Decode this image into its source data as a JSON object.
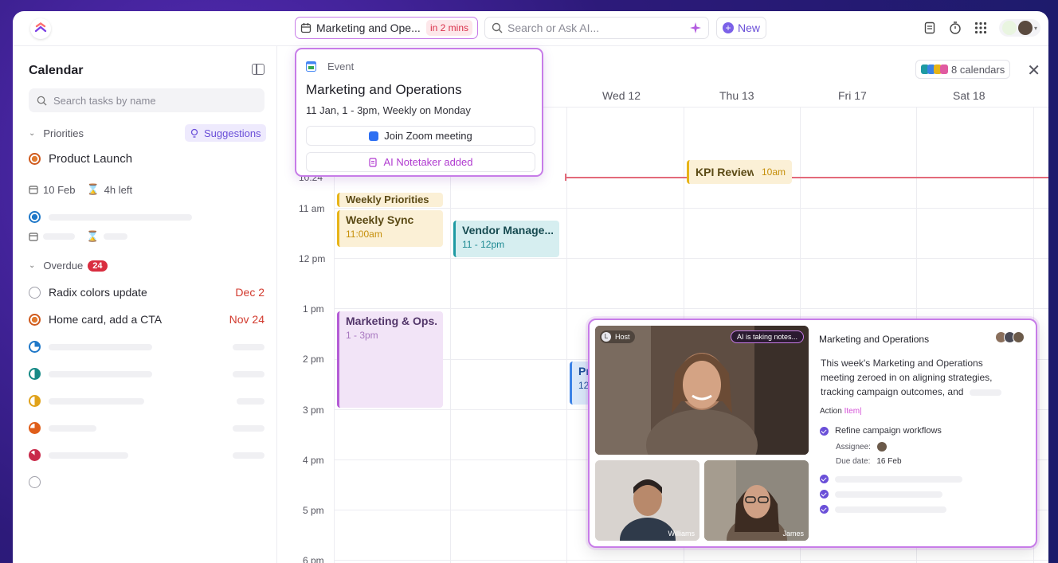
{
  "topbar": {
    "event_pill": {
      "title": "Marketing and Ope...",
      "soon": "in 2 mins"
    },
    "search_placeholder": "Search or Ask AI...",
    "new_label": "New"
  },
  "sidebar": {
    "title": "Calendar",
    "search_placeholder": "Search tasks by name",
    "priorities_label": "Priorities",
    "suggestions_label": "Suggestions",
    "priority_task": {
      "name": "Product Launch",
      "date": "10 Feb",
      "time_left": "4h left"
    },
    "overdue_label": "Overdue",
    "overdue_count": "24",
    "overdue_tasks": [
      {
        "name": "Radix colors update",
        "due": "Dec 2"
      },
      {
        "name": "Home card, add a CTA",
        "due": "Nov 24"
      }
    ]
  },
  "calendar": {
    "calendars_chip": "8 calendars",
    "days": [
      "Wed  12",
      "Thu  13",
      "Fri  17",
      "Sat  18"
    ],
    "hours": [
      "10:24",
      "11 am",
      "12 pm",
      "1 pm",
      "2 pm",
      "3 pm",
      "4 pm",
      "5 pm",
      "6 pm"
    ],
    "events": {
      "weekly_priorities": {
        "title": "Weekly Priorities"
      },
      "weekly_sync": {
        "title": "Weekly Sync",
        "time": "11:00am"
      },
      "vendor": {
        "title": "Vendor Manage...",
        "time": "11 - 12pm"
      },
      "kpi": {
        "title": "KPI Review",
        "time": "10am"
      },
      "mkt_ops": {
        "title": "Marketing & Ops...",
        "time": "1 - 3pm"
      },
      "pr": {
        "title": "Pr",
        "time": "12"
      }
    },
    "colors": {
      "yellow": "#e7b418",
      "teal": "#1e9aa3",
      "purple": "#b45cd6",
      "now": "#e36a7a"
    }
  },
  "popover": {
    "type": "Event",
    "title": "Marketing and Operations",
    "when": "11 Jan, 1 - 3pm, Weekly on Monday",
    "zoom_label": "Join Zoom meeting",
    "notetaker_label": "AI Notetaker added"
  },
  "meeting": {
    "host_label": "Host",
    "host_initial": "L",
    "ai_label": "AI is taking notes...",
    "participant_1": "Williams",
    "participant_2": "James",
    "title": "Marketing and Operations",
    "summary": "This week's Marketing and Operations meeting zeroed in on aligning strategies, tracking campaign outcomes, and",
    "action_prefix": "Action",
    "action_hl": "Item",
    "item1": "Refine campaign workflows",
    "assignee_label": "Assignee:",
    "due_label": "Due date:",
    "due_value": "16 Feb"
  }
}
